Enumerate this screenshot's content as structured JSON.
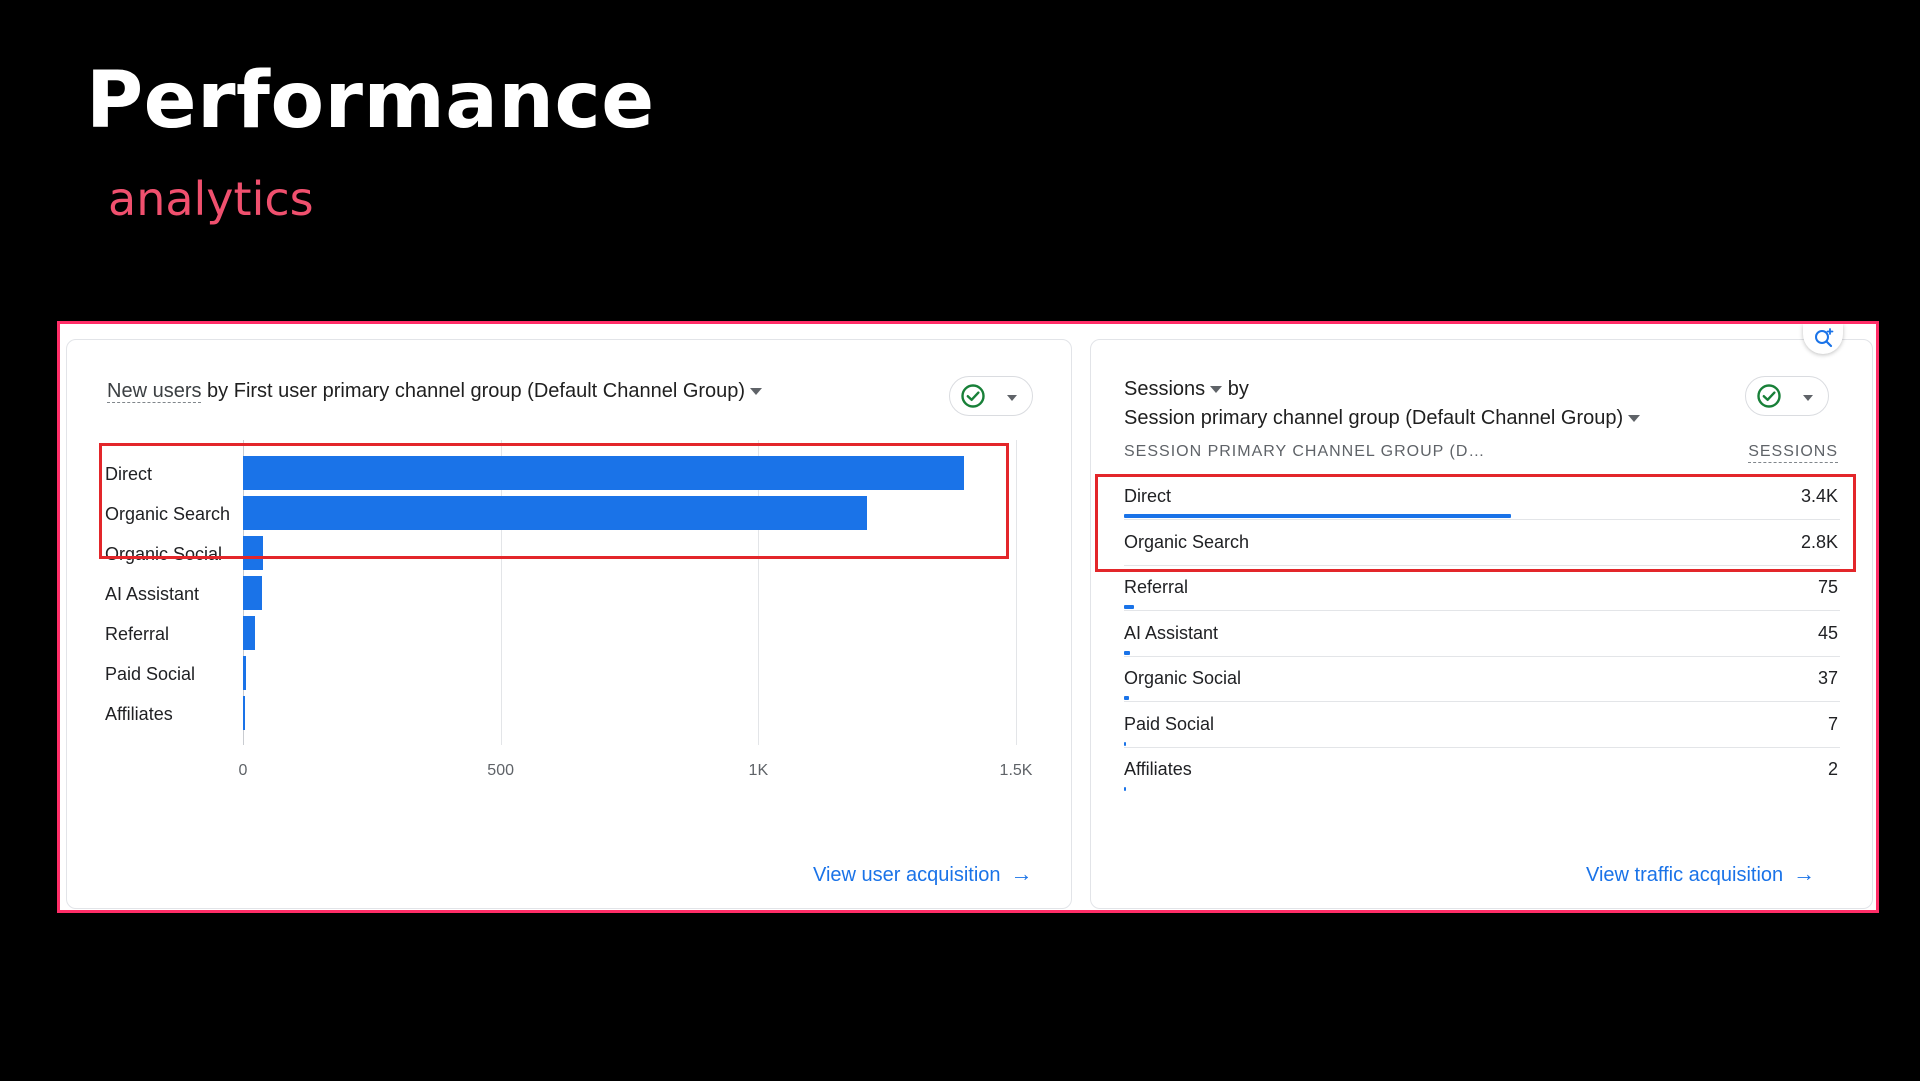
{
  "slide": {
    "title": "Performance",
    "subtitle": "analytics"
  },
  "colors": {
    "background": "#000000",
    "accent": "#f0506e",
    "frame_border": "#ff2d67",
    "highlight_box": "#e3262a",
    "bar": "#1a73e8",
    "link": "#1a73e8",
    "check": "#188038"
  },
  "left_card": {
    "title_metric": "New users",
    "title_rest": " by First user primary channel group (Default Channel Group)",
    "status_icon": "check-circle-icon",
    "link_label": "View user acquisition",
    "link_icon": "arrow-right-icon"
  },
  "right_card": {
    "title_metric": "Sessions",
    "title_by": " by",
    "title_dimension": "Session primary channel group (Default Channel Group)",
    "column_dimension": "SESSION PRIMARY CHANNEL GROUP (D…",
    "column_metric": "SESSIONS",
    "link_label": "View traffic acquisition",
    "status_icon": "check-circle-icon",
    "zoom_icon": "zoom-insights-icon",
    "rows": [
      {
        "label": "Direct",
        "value": "3.4K",
        "fraction": 0.54
      },
      {
        "label": "Organic Search",
        "value": "2.8K",
        "fraction": 0.0
      },
      {
        "label": "Referral",
        "value": "75",
        "fraction": 0.014
      },
      {
        "label": "AI Assistant",
        "value": "45",
        "fraction": 0.008
      },
      {
        "label": "Organic Social",
        "value": "37",
        "fraction": 0.007
      },
      {
        "label": "Paid Social",
        "value": "7",
        "fraction": 0.002
      },
      {
        "label": "Affiliates",
        "value": "2",
        "fraction": 0.001
      }
    ]
  },
  "chart_data": {
    "type": "bar",
    "orientation": "horizontal",
    "categories": [
      "Direct",
      "Organic Search",
      "Organic Social",
      "AI Assistant",
      "Referral",
      "Paid Social",
      "Affiliates"
    ],
    "values": [
      1400,
      1210,
      38,
      36,
      24,
      6,
      4
    ],
    "xlim": [
      0,
      1500
    ],
    "ticks": [
      0,
      500,
      1000,
      1500
    ],
    "tick_labels": [
      "0",
      "500",
      "1K",
      "1.5K"
    ],
    "grid": true,
    "title": "New users by First user primary channel group (Default Channel Group)"
  }
}
